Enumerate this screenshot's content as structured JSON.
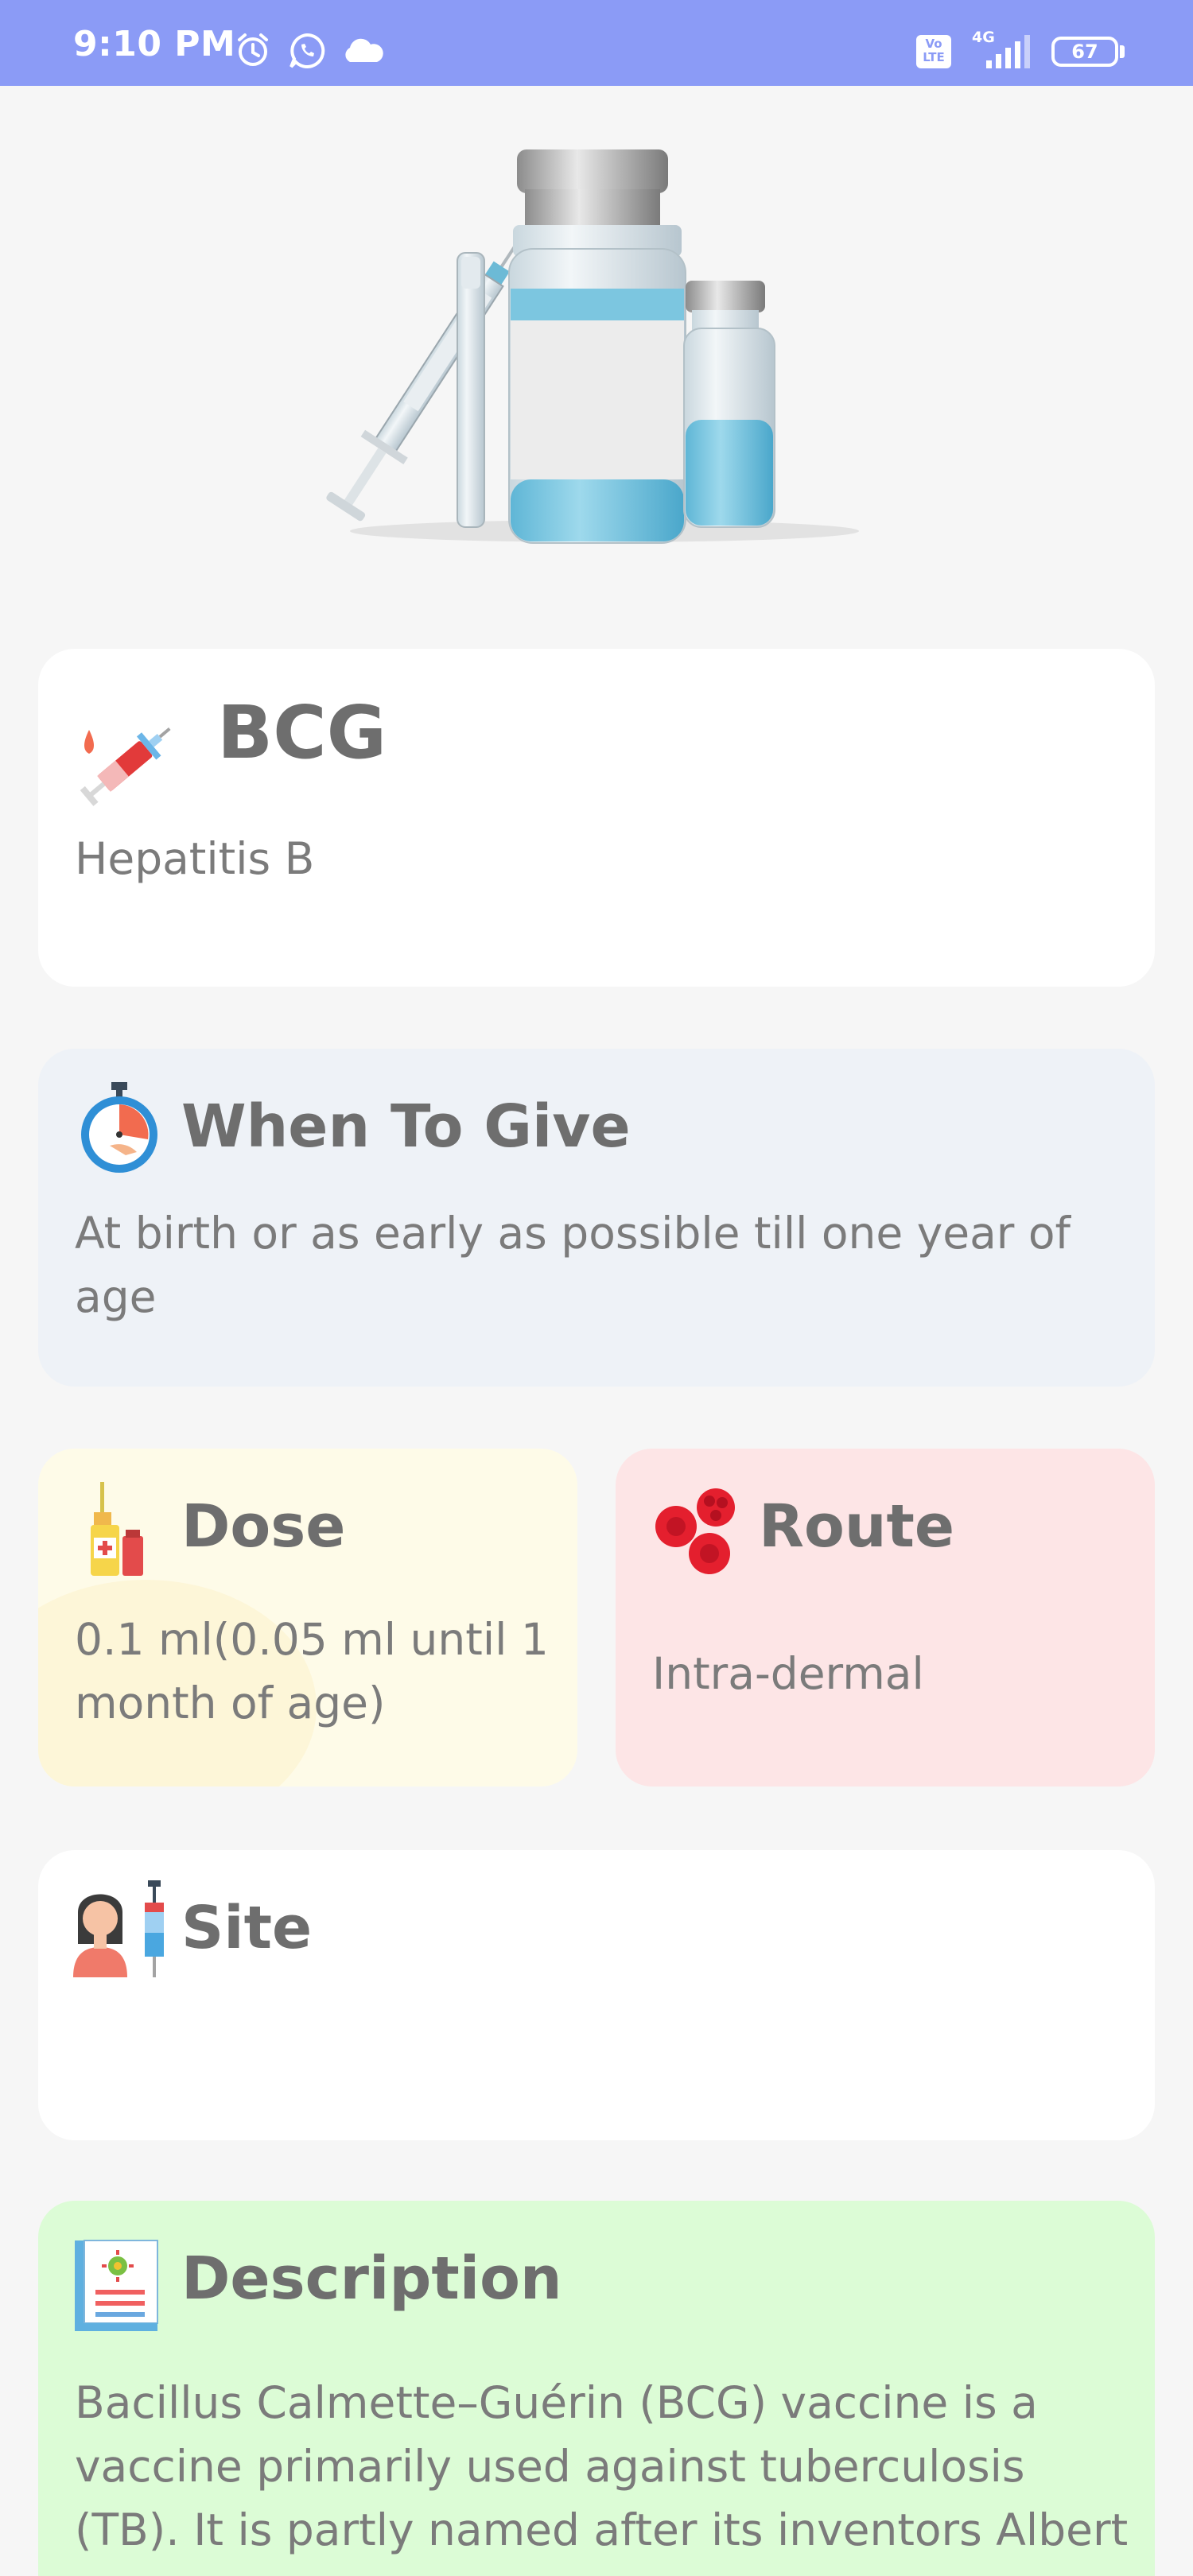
{
  "status_bar": {
    "time": "9:10 PM",
    "battery": "67",
    "network": "4G",
    "volte": "Vo LTE",
    "icons": [
      "alarm-icon",
      "whatsapp-icon",
      "cloud-icon",
      "volte-icon",
      "signal-icon",
      "battery-icon"
    ]
  },
  "vaccine": {
    "name": "BCG",
    "subtitle": "Hepatitis B"
  },
  "when_to_give": {
    "title": "When To Give",
    "text": "At birth or as early as possible till one year of age"
  },
  "dose": {
    "title": "Dose",
    "text": "0.1 ml(0.05 ml until 1 month of age)"
  },
  "route": {
    "title": "Route",
    "text": "Intra-dermal"
  },
  "site": {
    "title": "Site",
    "text": ""
  },
  "description": {
    "title": "Description",
    "text": "Bacillus Calmette–Guérin (BCG) vaccine is a vaccine primarily used against tuberculosis (TB). It is partly named after its inventors Albert"
  },
  "colors": {
    "status_bar": "#8b9bf6",
    "page_bg": "#f6f6f6",
    "when_card": "#eef2f7",
    "dose_card": "#fefbe8",
    "route_card": "#fde5e6",
    "description_card": "#dcfcd6"
  }
}
